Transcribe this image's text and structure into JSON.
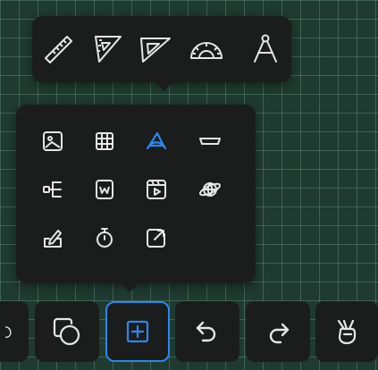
{
  "colors": {
    "board_background": "#1f3a30",
    "panel_background": "#1a1d1c",
    "icon_color": "#e6e6e6",
    "accent": "#2f86f0"
  },
  "ruler_tools": [
    {
      "icon": "ruler-icon"
    },
    {
      "icon": "set-square-icon"
    },
    {
      "icon": "triangle-ruler-icon"
    },
    {
      "icon": "protractor-icon"
    },
    {
      "icon": "compass-icon"
    }
  ],
  "insert_tools": [
    {
      "icon": "image-icon"
    },
    {
      "icon": "table-icon"
    },
    {
      "icon": "ruler-tools-icon",
      "active": true
    },
    {
      "icon": "shape-bar-icon"
    },
    {
      "icon": "mind-map-icon"
    },
    {
      "icon": "document-icon"
    },
    {
      "icon": "video-icon"
    },
    {
      "icon": "globe-icon"
    },
    {
      "icon": "note-icon"
    },
    {
      "icon": "timer-icon"
    },
    {
      "icon": "export-icon"
    }
  ],
  "toolbar": [
    {
      "icon": "partial-tool-icon"
    },
    {
      "icon": "shapes-icon"
    },
    {
      "icon": "insert-icon",
      "active": true
    },
    {
      "icon": "undo-icon"
    },
    {
      "icon": "redo-icon"
    },
    {
      "icon": "gesture-icon"
    }
  ]
}
